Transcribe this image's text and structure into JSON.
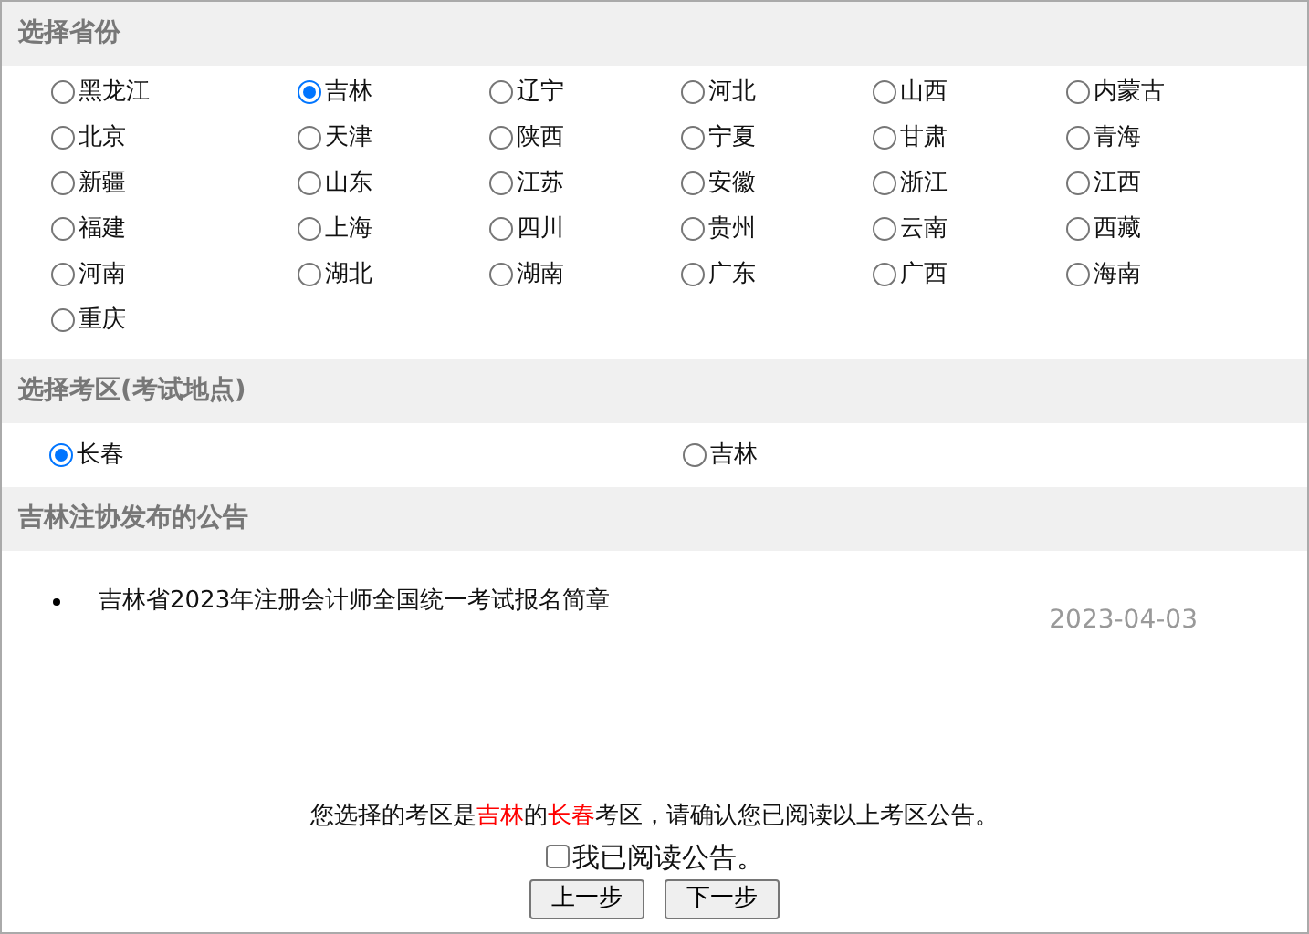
{
  "province_section": {
    "title": "选择省份",
    "provinces": [
      {
        "label": "黑龙江",
        "selected": false
      },
      {
        "label": "吉林",
        "selected": true
      },
      {
        "label": "辽宁",
        "selected": false
      },
      {
        "label": "河北",
        "selected": false
      },
      {
        "label": "山西",
        "selected": false
      },
      {
        "label": "内蒙古",
        "selected": false
      },
      {
        "label": "北京",
        "selected": false
      },
      {
        "label": "天津",
        "selected": false
      },
      {
        "label": "陕西",
        "selected": false
      },
      {
        "label": "宁夏",
        "selected": false
      },
      {
        "label": "甘肃",
        "selected": false
      },
      {
        "label": "青海",
        "selected": false
      },
      {
        "label": "新疆",
        "selected": false
      },
      {
        "label": "山东",
        "selected": false
      },
      {
        "label": "江苏",
        "selected": false
      },
      {
        "label": "安徽",
        "selected": false
      },
      {
        "label": "浙江",
        "selected": false
      },
      {
        "label": "江西",
        "selected": false
      },
      {
        "label": "福建",
        "selected": false
      },
      {
        "label": "上海",
        "selected": false
      },
      {
        "label": "四川",
        "selected": false
      },
      {
        "label": "贵州",
        "selected": false
      },
      {
        "label": "云南",
        "selected": false
      },
      {
        "label": "西藏",
        "selected": false
      },
      {
        "label": "河南",
        "selected": false
      },
      {
        "label": "湖北",
        "selected": false
      },
      {
        "label": "湖南",
        "selected": false
      },
      {
        "label": "广东",
        "selected": false
      },
      {
        "label": "广西",
        "selected": false
      },
      {
        "label": "海南",
        "selected": false
      },
      {
        "label": "重庆",
        "selected": false
      }
    ]
  },
  "area_section": {
    "title": "选择考区(考试地点)",
    "areas": [
      {
        "label": "长春",
        "selected": true
      },
      {
        "label": "吉林",
        "selected": false
      }
    ]
  },
  "notice_section": {
    "title": "吉林注协发布的公告",
    "notices": [
      {
        "title": "吉林省2023年注册会计师全国统一考试报名简章",
        "date": "2023-04-03"
      }
    ]
  },
  "confirmation": {
    "parts": [
      {
        "kind": "plain",
        "text": "您选择的考区是"
      },
      {
        "kind": "highlight",
        "text": "吉林"
      },
      {
        "kind": "plain",
        "text": "的"
      },
      {
        "kind": "highlight",
        "text": "长春"
      },
      {
        "kind": "plain",
        "text": "考区，请确认您已阅读以上考区公告。"
      }
    ],
    "checkbox": {
      "label": "我已阅读公告。",
      "checked": false
    }
  },
  "buttons": [
    "上一步",
    "下一步"
  ]
}
